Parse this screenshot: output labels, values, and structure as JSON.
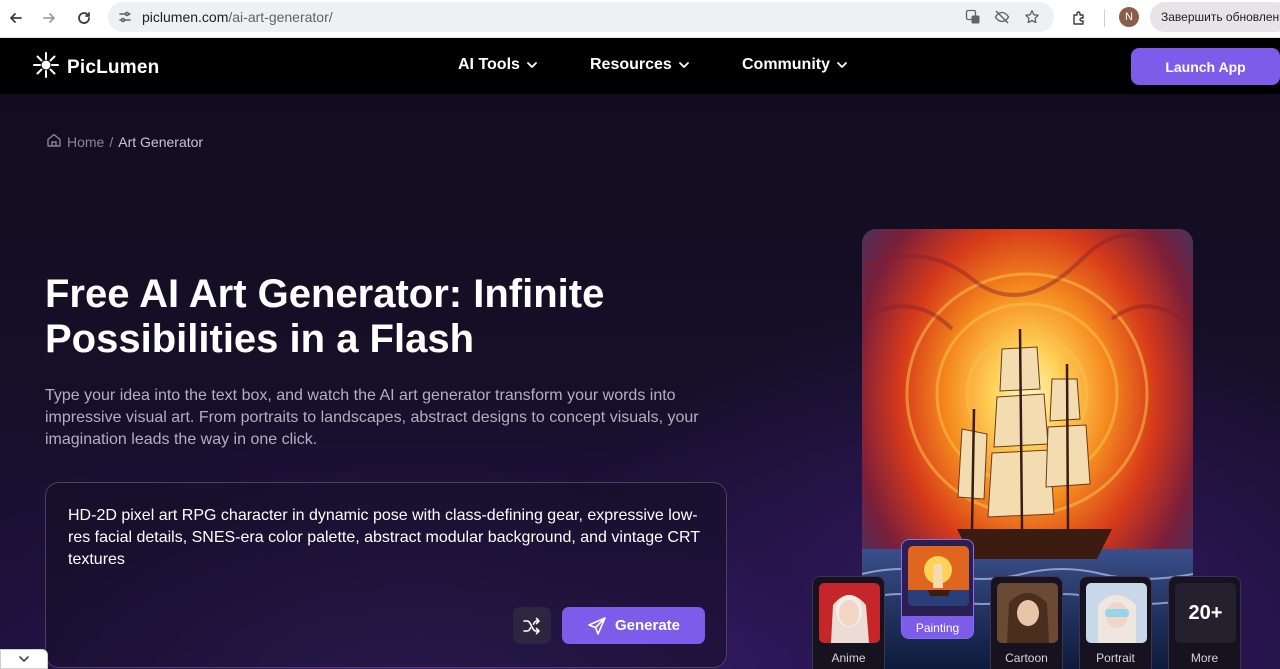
{
  "browser": {
    "url_domain": "piclumen.com",
    "url_path": "/ai-art-generator/",
    "avatar_letter": "N",
    "finish_label": "Завершить обновление"
  },
  "header": {
    "logo_text": "PicLumen",
    "nav": [
      {
        "label": "AI Tools"
      },
      {
        "label": "Resources"
      },
      {
        "label": "Community"
      }
    ],
    "launch_label": "Launch App"
  },
  "breadcrumb": {
    "home": "Home",
    "separator": "/",
    "current": "Art Generator"
  },
  "hero": {
    "title": "Free AI Art Generator: Infinite Possibilities in a Flash",
    "description": "Type your idea into the text box, and watch the AI art generator transform your words into impressive visual art. From portraits to landscapes, abstract designs to concept visuals, your imagination leads the way in one click.",
    "prompt": "HD-2D pixel art RPG character in dynamic pose with class-defining gear, expressive low-res facial details, SNES-era color palette, abstract modular background, and vintage CRT textures",
    "generate_label": "Generate"
  },
  "styles": [
    {
      "label": "Anime"
    },
    {
      "label": "Painting"
    },
    {
      "label": "Cartoon"
    },
    {
      "label": "Portrait"
    },
    {
      "label": "More",
      "count": "20+"
    }
  ],
  "colors": {
    "accent": "#7c5ce8",
    "header_bg": "#000000",
    "hero_bg": "#160f28"
  }
}
